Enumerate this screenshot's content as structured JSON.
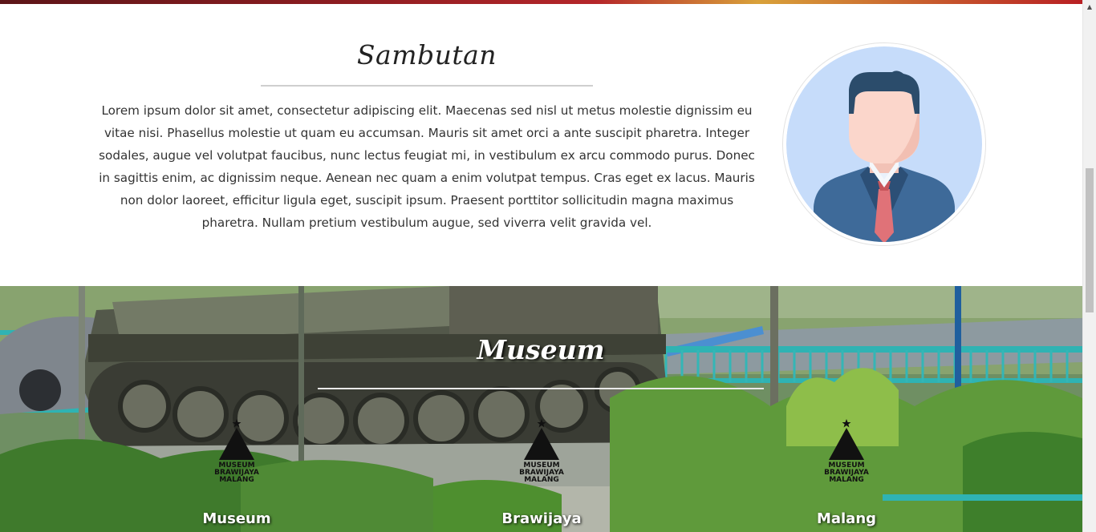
{
  "sambutan": {
    "title": "Sambutan",
    "body": "Lorem ipsum dolor sit amet, consectetur adipiscing elit. Maecenas sed nisl ut metus molestie dignissim eu vitae nisi. Phasellus molestie ut quam eu accumsan. Mauris sit amet orci a ante suscipit pharetra. Integer sodales, augue vel volutpat faucibus, nunc lectus feugiat mi, in vestibulum ex arcu commodo purus. Donec in sagittis enim, ac dignissim neque. Aenean nec quam a enim volutpat tempus. Cras eget ex lacus. Mauris non dolor laoreet, efficitur ligula eget, suscipit ipsum. Praesent porttitor sollicitudin magna maximus pharetra. Nullam pretium vestibulum augue, sed viverra velit gravida vel.",
    "avatar_icon": "businessman-avatar-icon"
  },
  "museum": {
    "title": "Museum",
    "cards": [
      {
        "label": "Museum",
        "logo_lines": [
          "MUSEUM",
          "BRAWIJAYA",
          "MALANG"
        ]
      },
      {
        "label": "Brawijaya",
        "logo_lines": [
          "MUSEUM",
          "BRAWIJAYA",
          "MALANG"
        ]
      },
      {
        "label": "Malang",
        "logo_lines": [
          "MUSEUM",
          "BRAWIJAYA",
          "MALANG"
        ]
      }
    ]
  },
  "scrollbar": {
    "up_icon": "scroll-up-arrow-icon"
  },
  "colors": {
    "accent_red": "#b5262a",
    "avatar_bg": "#c6dcfa",
    "suit": "#3e6a99",
    "tie": "#e07278"
  }
}
